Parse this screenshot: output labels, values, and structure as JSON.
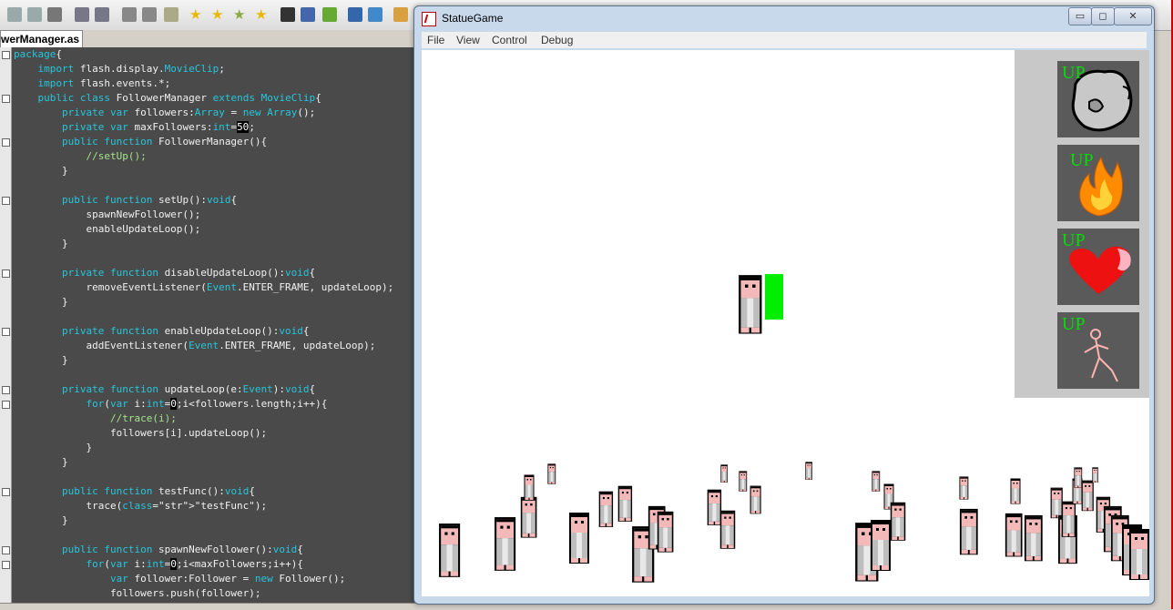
{
  "ide": {
    "tab_label": "werManager.as",
    "toolbar_icons": [
      "save-icon",
      "save-all-icon",
      "print-icon",
      "undo-icon",
      "redo-icon",
      "cut-icon",
      "copy-icon",
      "paste-icon",
      "star-icon",
      "star-add-icon",
      "star-next-icon",
      "star-prev-icon",
      "terminal-icon",
      "panel-icon",
      "run-icon",
      "check-icon",
      "clock-icon",
      "package-icon"
    ],
    "code_lines": [
      "package{",
      "    import flash.display.MovieClip;",
      "    import flash.events.*;",
      "    public class FollowerManager extends MovieClip{",
      "        private var followers:Array = new Array();",
      "        private var maxFollowers:int=50;",
      "        public function FollowerManager(){",
      "            //setUp();",
      "        }",
      "",
      "        public function setUp():void{",
      "            spawnNewFollower();",
      "            enableUpdateLoop();",
      "        }",
      "",
      "        private function disableUpdateLoop():void{",
      "            removeEventListener(Event.ENTER_FRAME, updateLoop);",
      "        }",
      "",
      "        private function enableUpdateLoop():void{",
      "            addEventListener(Event.ENTER_FRAME, updateLoop);",
      "        }",
      "",
      "        private function updateLoop(e:Event):void{",
      "            for(var i:int=0;i<followers.length;i++){",
      "                //trace(i);",
      "                followers[i].updateLoop();",
      "            }",
      "        }",
      "",
      "        public function testFunc():void{",
      "            trace(\"testFunc\");",
      "        }",
      "",
      "        public function spawnNewFollower():void{",
      "            for(var i:int=0;i<maxFollowers;i++){",
      "                var follower:Follower = new Follower();",
      "                followers.push(follower);"
    ]
  },
  "window": {
    "title": "StatueGame",
    "menu": [
      "File",
      "View",
      "Control",
      "Debug"
    ],
    "controls": {
      "minimize": "▭",
      "maximize": "◻",
      "close": "✕"
    }
  },
  "game": {
    "upgrades": [
      {
        "label": "UP",
        "icon": "rock-icon"
      },
      {
        "label": "UP",
        "icon": "fire-icon"
      },
      {
        "label": "UP",
        "icon": "heart-icon"
      },
      {
        "label": "UP",
        "icon": "stick-figure-icon"
      }
    ],
    "colors": {
      "upgrade_text": "#00dd00",
      "health_bar": "#00ee00",
      "panel_bg": "#c8c8c8",
      "button_bg": "#5a5a5a"
    }
  }
}
